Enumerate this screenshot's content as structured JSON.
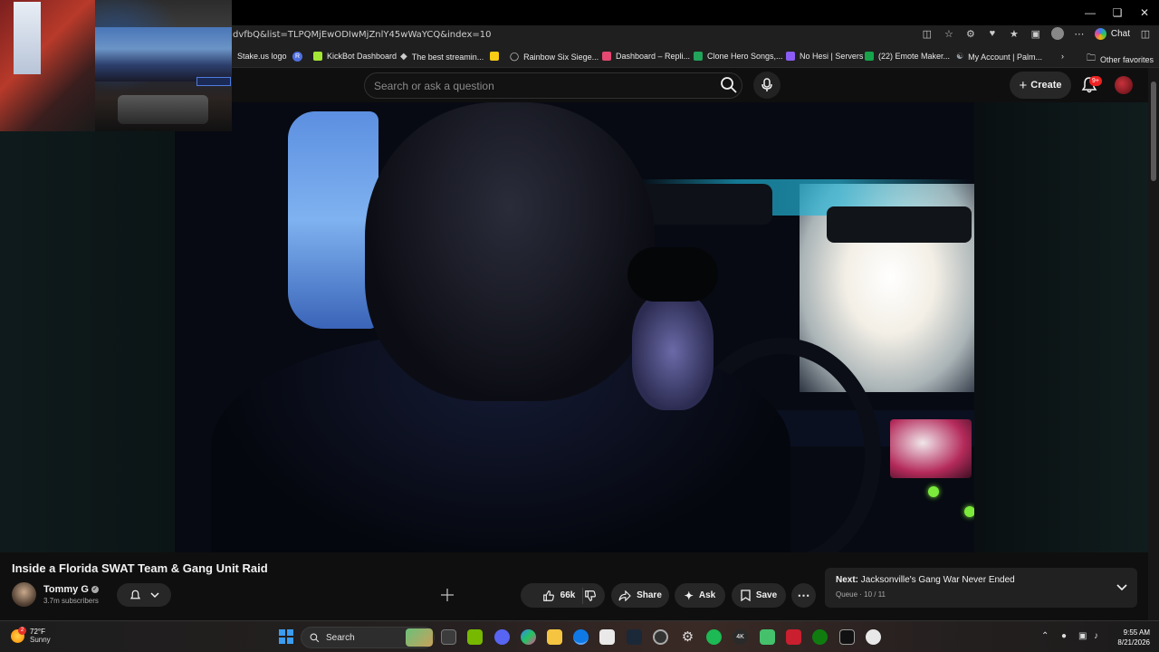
{
  "browser": {
    "url": "dvfbQ&list=TLPQMjEwODIwMjZnlY45wWaYCQ&index=10",
    "chat_label": "Chat",
    "other_favorites": "Other favorites"
  },
  "bookmarks": [
    {
      "label": "Stake.us logo",
      "color": "#2b2b2b",
      "icon": ""
    },
    {
      "label": "",
      "color": "#4f6fe0",
      "icon": "R"
    },
    {
      "label": "KickBot Dashboard",
      "color": "#a3e635",
      "icon": "kick-icon"
    },
    {
      "label": "The best streamin...",
      "color": "#cccccc",
      "icon": "diamond-icon"
    },
    {
      "label": "",
      "color": "#facc15",
      "icon": "snap-icon"
    },
    {
      "label": "Rainbow Six Siege...",
      "color": "#dddddd",
      "icon": "r6-icon"
    },
    {
      "label": "Dashboard – Repli...",
      "color": "#e54870",
      "icon": "replit-icon"
    },
    {
      "label": "Clone Hero Songs,...",
      "color": "#22a35a",
      "icon": "sheets-icon"
    },
    {
      "label": "No Hesi | Servers",
      "color": "#8b5cf6",
      "icon": "n-icon"
    },
    {
      "label": "(22) Emote Maker...",
      "color": "#16a34a",
      "icon": "emote-icon"
    },
    {
      "label": "My Account | Palm...",
      "color": "#9aa0a6",
      "icon": "palm-icon"
    }
  ],
  "yt": {
    "search_placeholder": "Search or ask a question",
    "create_label": "Create",
    "notif_count": "9+"
  },
  "video": {
    "title": "Inside a Florida SWAT Team & Gang Unit Raid",
    "channel": "Tommy G",
    "subscribers": "3.7m subscribers",
    "likes": "66k",
    "share_label": "Share",
    "ask_label": "Ask",
    "save_label": "Save"
  },
  "next": {
    "prefix": "Next:",
    "title": "Jacksonville's Gang War Never Ended",
    "queue": "Queue · 10 / 11"
  },
  "taskbar": {
    "temperature": "72°F",
    "condition": "Sunny",
    "weather_badge": "2",
    "search_label": "Search",
    "time": "9:55 AM",
    "date": "8/21/2026"
  },
  "colors": {
    "accent_blue": "#3b9cf0",
    "notif_red": "#e22222",
    "led_green": "#7bea3b"
  }
}
